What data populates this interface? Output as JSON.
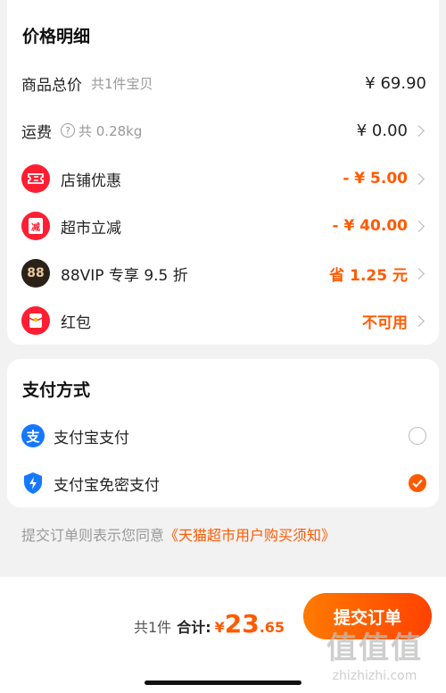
{
  "price_details": {
    "title": "价格明细",
    "items_total": {
      "label": "商品总价",
      "sub": "共1件宝贝",
      "value": "¥ 69.90"
    },
    "shipping": {
      "label": "运费",
      "weight": "共 0.28kg",
      "value": "¥ 0.00"
    },
    "store_discount": {
      "label": "店铺优惠",
      "value": "- ¥ 5.00",
      "icon": "ticket-icon"
    },
    "market_reduction": {
      "label": "超市立减",
      "value": "- ¥ 40.00",
      "icon_text": "减"
    },
    "vip": {
      "label": "88VIP 专享 9.5 折",
      "value": "省 1.25 元",
      "icon_text": "88"
    },
    "red_packet": {
      "label": "红包",
      "value": "不可用",
      "icon": "red-envelope-icon"
    }
  },
  "payment": {
    "title": "支付方式",
    "options": [
      {
        "label": "支付宝支付",
        "icon": "alipay-icon",
        "selected": false
      },
      {
        "label": "支付宝免密支付",
        "icon": "shield-icon",
        "selected": true
      }
    ]
  },
  "agreement": {
    "prefix": "提交订单则表示您同意",
    "link": "《天猫超市用户购买须知》"
  },
  "footer": {
    "count": "共1件",
    "total_label": "合计:",
    "currency": "¥",
    "amount_int": "23",
    "amount_dec": ".65",
    "submit_label": "提交订单"
  },
  "watermark": {
    "big": "值值值",
    "small": "zhizhizhi.com"
  },
  "colors": {
    "accent": "#ff5a00",
    "icon_red": "#ff1e32",
    "alipay_blue": "#1677ff",
    "vip_dark": "#2a2118"
  }
}
